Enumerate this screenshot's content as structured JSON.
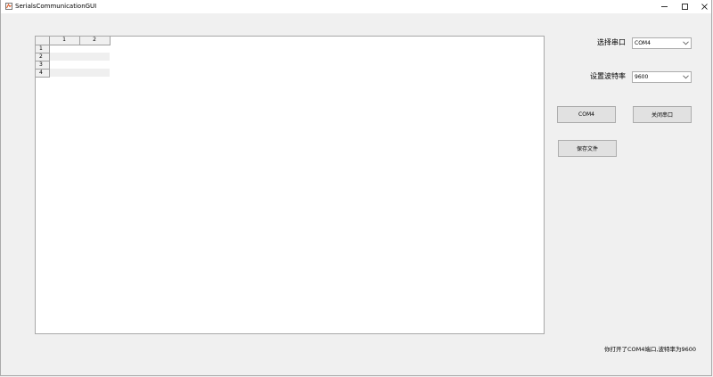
{
  "window": {
    "title": "SerialsCommunicationGUI",
    "icon": "matlab-icon",
    "controls": [
      "minimize-icon",
      "maximize-icon",
      "close-icon"
    ]
  },
  "table": {
    "columns": [
      "1",
      "2"
    ],
    "rows": [
      {
        "label": "1",
        "cells": [
          "",
          ""
        ]
      },
      {
        "label": "2",
        "cells": [
          "",
          ""
        ]
      },
      {
        "label": "3",
        "cells": [
          "",
          ""
        ]
      },
      {
        "label": "4",
        "cells": [
          "",
          ""
        ]
      }
    ]
  },
  "port": {
    "label": "选择串口",
    "selected": "COM4"
  },
  "baud": {
    "label": "设置波特率",
    "selected": "9600"
  },
  "buttons": {
    "open_port": "COM4",
    "close_port": "关闭串口",
    "save_file": "保存文件"
  },
  "status": {
    "text": "你打开了COM4端口,波特率为9600"
  },
  "colors": {
    "background": "#f0f0f0",
    "button_face": "#e1e1e1",
    "table_alt_row": "#efefef"
  }
}
